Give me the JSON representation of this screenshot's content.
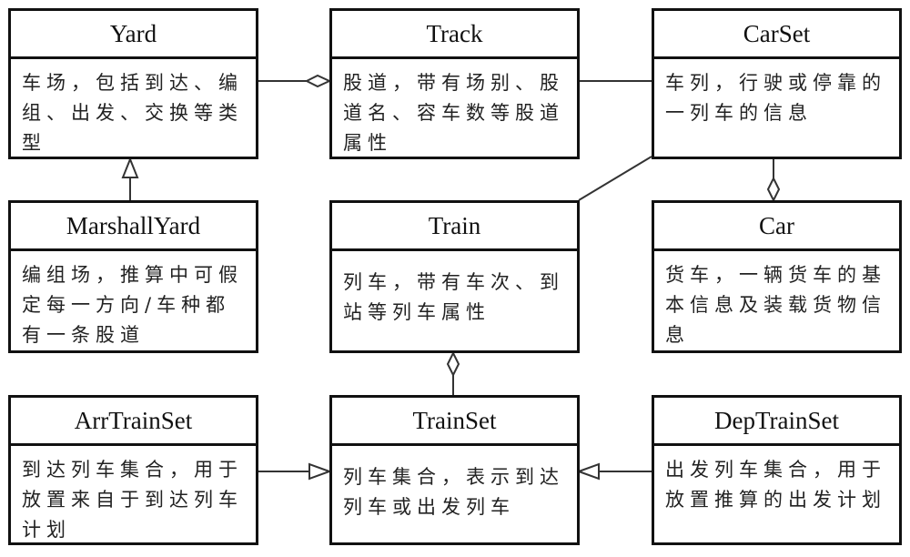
{
  "diagram": {
    "type": "UML class diagram",
    "classes": {
      "yard": {
        "name": "Yard",
        "desc": "车场，包括到达、编组、出发、交换等类型"
      },
      "track": {
        "name": "Track",
        "desc": "股道，带有场别、股道名、容车数等股道属性"
      },
      "carset": {
        "name": "CarSet",
        "desc": "车列，行驶或停靠的一列车的信息"
      },
      "marshallyard": {
        "name": "MarshallYard",
        "desc": "编组场，推算中可假定每一方向/车种都有一条股道"
      },
      "train": {
        "name": "Train",
        "desc": "列车，带有车次、到站等列车属性"
      },
      "car": {
        "name": "Car",
        "desc": "货车，一辆货车的基本信息及装载货物信息"
      },
      "arrtrainset": {
        "name": "ArrTrainSet",
        "desc": "到达列车集合，用于放置来自于到达列车计划"
      },
      "trainset": {
        "name": "TrainSet",
        "desc": "列车集合，表示到达列车或出发列车"
      },
      "deptrainset": {
        "name": "DepTrainSet",
        "desc": "出发列车集合，用于放置推算的出发计划"
      }
    },
    "relations": [
      {
        "from": "Yard",
        "to": "Track",
        "type": "aggregation"
      },
      {
        "from": "Track",
        "to": "CarSet",
        "type": "association"
      },
      {
        "from": "CarSet",
        "to": "Train",
        "type": "association"
      },
      {
        "from": "Car",
        "to": "CarSet",
        "type": "aggregation"
      },
      {
        "from": "MarshallYard",
        "to": "Yard",
        "type": "generalization"
      },
      {
        "from": "TrainSet",
        "to": "Train",
        "type": "aggregation"
      },
      {
        "from": "ArrTrainSet",
        "to": "TrainSet",
        "type": "generalization"
      },
      {
        "from": "DepTrainSet",
        "to": "TrainSet",
        "type": "generalization"
      }
    ]
  }
}
